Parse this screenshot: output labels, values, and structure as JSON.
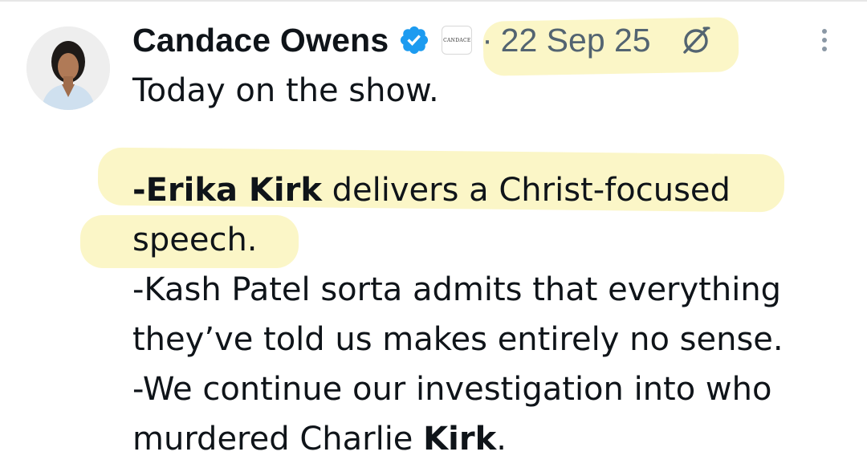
{
  "post": {
    "author_name": "Candace Owens",
    "affiliate_badge_text": "CANDACE",
    "separator": "·",
    "date": "22 Sep 25",
    "lines": {
      "l1": "Today on the show.",
      "l3_bold": "-Erika Kirk",
      "l3_rest": " delivers a Christ-focused",
      "l4": "speech.",
      "l5": "-Kash Patel sorta admits that everything",
      "l6": "they’ve told us makes entirely no sense.",
      "l7": "-We continue our investigation into who",
      "l8_prefix": "murdered Charlie ",
      "l8_bold": "Kirk",
      "l8_suffix": "."
    }
  },
  "icons": {
    "verified": "verified-badge-icon",
    "grok": "grok-icon",
    "more": "more-options-icon"
  },
  "colors": {
    "text": "#0f1419",
    "muted": "#536471",
    "verified_blue": "#1d9bf0",
    "highlight": "#fbf6c4"
  }
}
